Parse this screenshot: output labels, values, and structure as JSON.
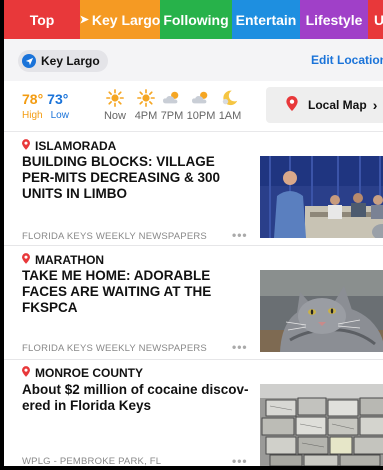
{
  "tabs": [
    {
      "label": "Top",
      "color": "#e8383a",
      "width": 76
    },
    {
      "label": "Key Largo",
      "color": "#f59a23",
      "width": 80,
      "selected": true
    },
    {
      "label": "Following",
      "color": "#27b24a",
      "width": 72
    },
    {
      "label": "Entertain",
      "color": "#1e8fe0",
      "width": 68
    },
    {
      "label": "Lifestyle",
      "color": "#a040c8",
      "width": 68
    },
    {
      "label": "U",
      "color": "#e8383a",
      "width": 19
    }
  ],
  "location": {
    "name": "Key Largo",
    "edit_label": "Edit Location"
  },
  "weather": {
    "high": "78°",
    "low": "73°",
    "high_label": "High",
    "low_label": "Low",
    "forecast": [
      {
        "time": "Now",
        "icon": "sun-icon"
      },
      {
        "time": "4PM",
        "icon": "sun-icon"
      },
      {
        "time": "7PM",
        "icon": "partly-cloudy-icon"
      },
      {
        "time": "10PM",
        "icon": "partly-cloudy-icon"
      },
      {
        "time": "1AM",
        "icon": "moon-icon"
      }
    ],
    "local_map_label": "Local Map"
  },
  "articles": [
    {
      "place": "ISLAMORADA",
      "headline": "BUILDING BLOCKS: VILLAGE PER-MITS DECREASING & 300 UNITS IN LIMBO",
      "source": "FLORIDA KEYS WEEKLY NEWSPAPERS",
      "more": "•••",
      "image": "village-council-meeting-photo"
    },
    {
      "place": "MARATHON",
      "headline": "TAKE ME HOME: ADORABLE FACES ARE WAITING AT THE FKSPCA",
      "source": "FLORIDA KEYS WEEKLY NEWSPAPERS",
      "more": "•••",
      "image": "gray-cat-photo"
    },
    {
      "place": "MONROE COUNTY",
      "headline": "About $2 million of cocaine discov-ered in Florida Keys",
      "source": "WPLG - PEMBROKE PARK, FL",
      "more": "•••",
      "image": "seized-cocaine-bricks-photo"
    }
  ]
}
